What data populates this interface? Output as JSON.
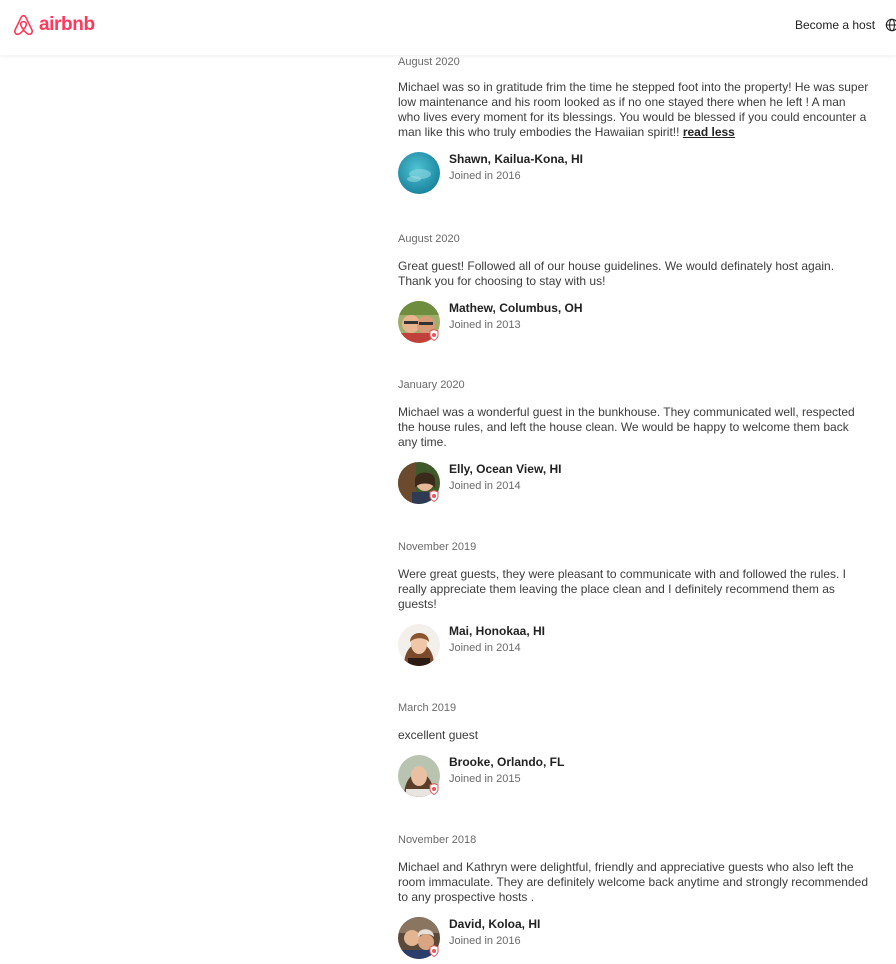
{
  "header": {
    "logo_text": "airbnb",
    "become_host": "Become a host",
    "brand_color": "#ff385c"
  },
  "reviews": [
    {
      "date": "August 2020",
      "text": "Michael was so in gratitude frim the time he stepped foot into the property! He was super low maintenance and his room looked as if no one stayed there when he left ! A man who lives every moment for its blessings. You would be blessed if you could encounter a man like this who truly embodies the Hawaiian spirit!!",
      "read_less": "read less",
      "name": "Shawn, Kailua-Kona, HI",
      "joined": "Joined in 2016"
    },
    {
      "date": "August 2020",
      "text": "Great guest! Followed all of our house guidelines. We would definately host again. Thank you for choosing to stay with us!",
      "name": "Mathew, Columbus, OH",
      "joined": "Joined in 2013"
    },
    {
      "date": "January 2020",
      "text": "Michael was a wonderful guest in the bunkhouse. They communicated well, respected the house rules, and left the house clean. We would be happy to welcome them back any time.",
      "name": "Elly, Ocean View, HI",
      "joined": "Joined in 2014"
    },
    {
      "date": "November 2019",
      "text": "Were great guests, they were pleasant to communicate with and followed the rules. I really appreciate them leaving the place clean and I definitely recommend them as guests!",
      "name": "Mai, Honokaa, HI",
      "joined": "Joined in 2014"
    },
    {
      "date": "March 2019",
      "text": "excellent guest",
      "name": "Brooke, Orlando, FL",
      "joined": "Joined in 2015"
    },
    {
      "date": "November 2018",
      "text": "Michael and Kathryn were delightful, friendly and appreciative guests who also left the room immaculate. They are definitely welcome back anytime and strongly recommended to any prospective hosts .",
      "name": "David, Koloa, HI",
      "joined": "Joined in 2016"
    }
  ]
}
